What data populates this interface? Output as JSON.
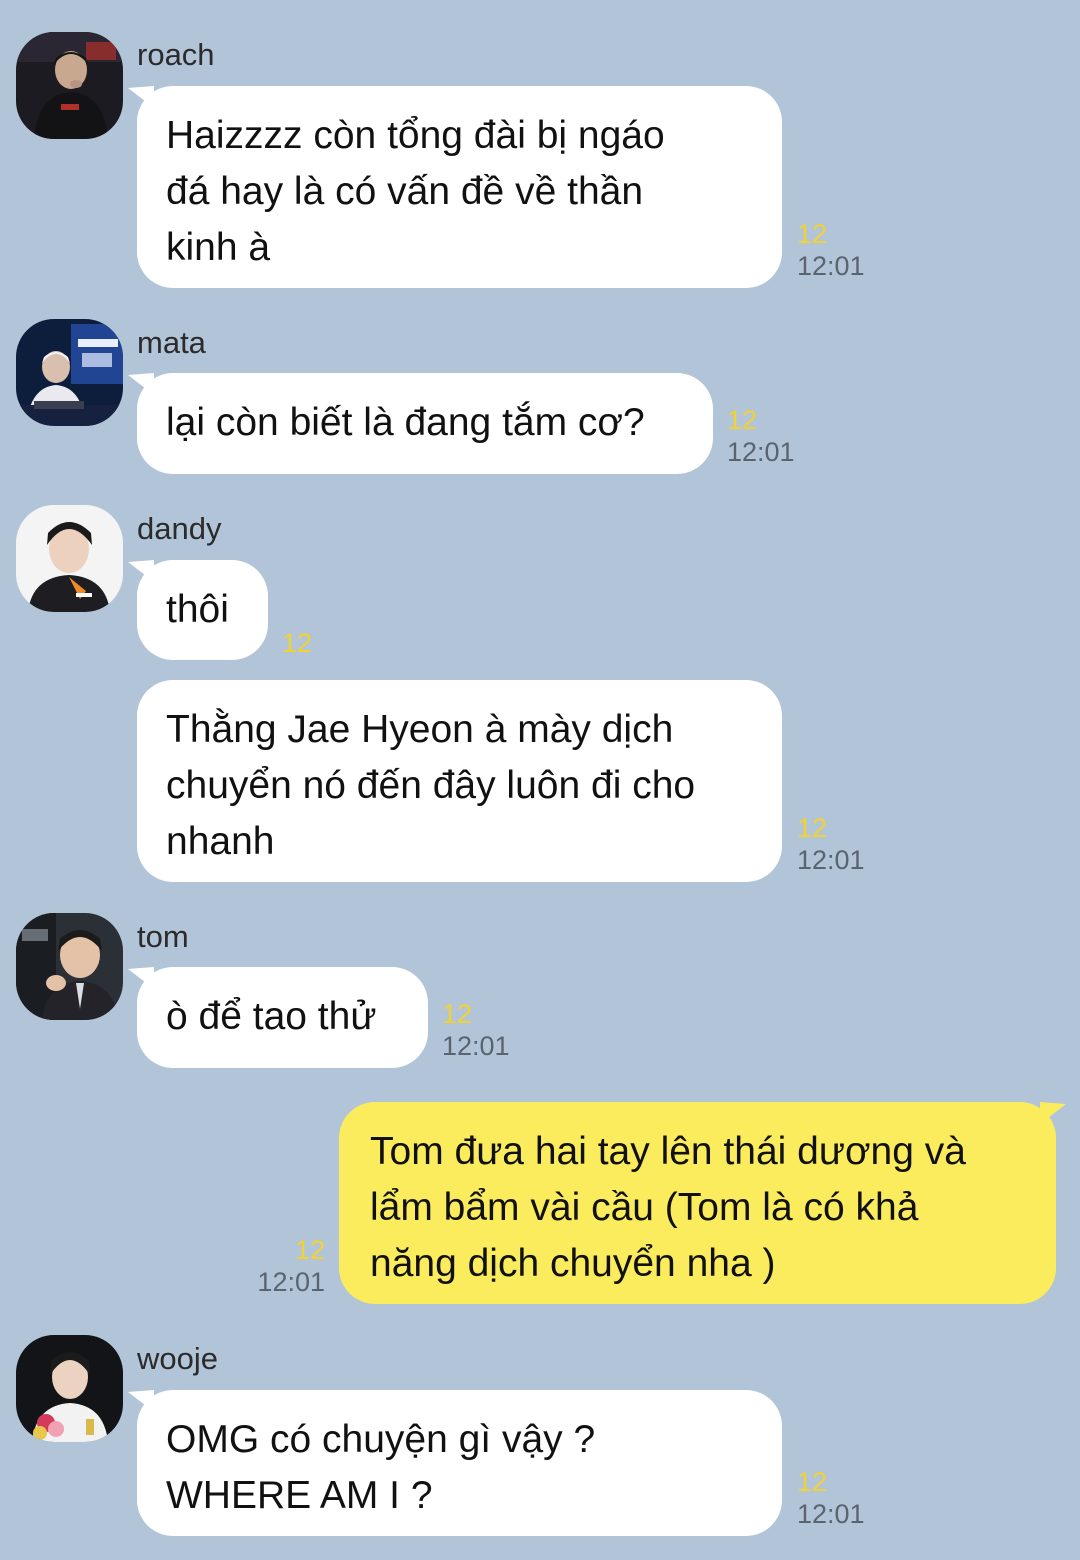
{
  "messages": [
    {
      "sender": "roach",
      "lines": [
        "Haizzzz còn tổng đài bị ngáo",
        "đá hay là có vấn đề về thần",
        "kinh à"
      ],
      "unread": "12",
      "time": "12:01"
    },
    {
      "sender": "mata",
      "lines": [
        "lại còn biết là đang tắm cơ?"
      ],
      "unread": "12",
      "time": "12:01"
    },
    {
      "sender": "dandy",
      "lines": [
        "thôi"
      ],
      "unread": "12"
    },
    {
      "sender": "dandy",
      "lines": [
        "Thằng Jae Hyeon à mày dịch",
        "chuyển nó đến đây luôn đi cho",
        "nhanh"
      ],
      "unread": "12",
      "time": "12:01"
    },
    {
      "sender": "tom",
      "lines": [
        "ò để tao thử"
      ],
      "unread": "12",
      "time": "12:01"
    },
    {
      "sender": "me",
      "lines": [
        "Tom  đưa hai tay lên thái dương và",
        "lẩm bẩm vài cầu (Tom  là có khả",
        "năng dịch chuyển nha )"
      ],
      "unread": "12",
      "time": "12:01"
    },
    {
      "sender": "wooje",
      "lines": [
        "OMG có chuyện gì vậy ?",
        "WHERE AM I ?"
      ],
      "unread": "12",
      "time": "12:01"
    }
  ],
  "colors": {
    "background": "#b2c5d8",
    "incoming_bubble": "#ffffff",
    "outgoing_bubble": "#fbec5d",
    "unread": "#f2d230",
    "time": "#5a6470"
  }
}
